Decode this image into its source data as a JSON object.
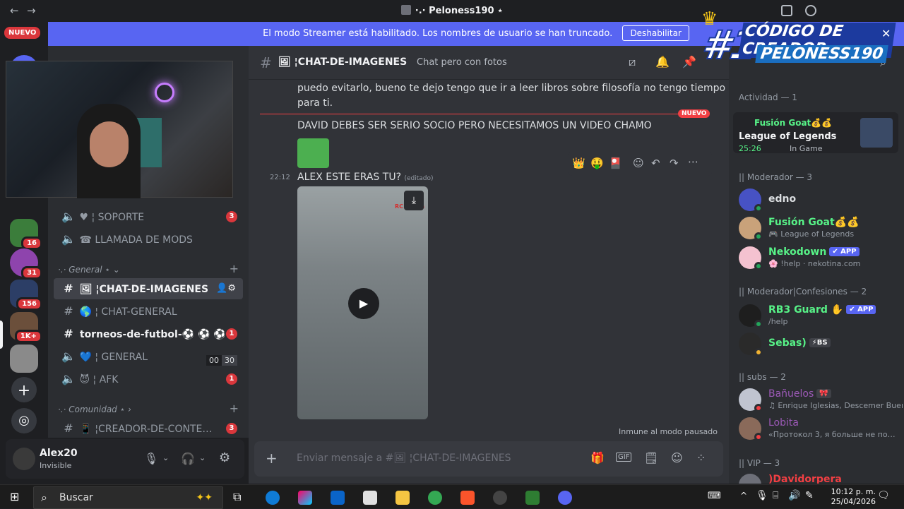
{
  "window": {
    "title": "·.· Peloness190 ⋆",
    "back": "←",
    "forward": "→"
  },
  "banner": {
    "text": "El modo Streamer está habilitado. Los nombres de usuario se han truncado.",
    "button": "Deshabilitar"
  },
  "promo": {
    "line1": "#1",
    "line2": "CÓDIGO DE CREADOR:",
    "line3": "PELONESS190"
  },
  "servers": {
    "nuevo": "NUEVO",
    "badges": [
      "16",
      "31",
      "156",
      "1K+"
    ]
  },
  "sidebar": {
    "channels_top": [
      {
        "icon": "speaker",
        "label": "♥ ¦ SOPORTE",
        "count": "3"
      },
      {
        "icon": "speaker",
        "label": "☎ LLAMADA DE MODS"
      }
    ],
    "category_general": "·.· General ⋆ ⌄",
    "channels_general": [
      {
        "icon": "#",
        "label": "🖼 ¦CHAT-DE-IMAGENES",
        "active": true
      },
      {
        "icon": "#",
        "label": "🌎 ¦ CHAT-GENERAL"
      },
      {
        "icon": "#",
        "label": "torneos-de-futbol-⚽ ⚽ ⚽",
        "count": "1",
        "unread": true
      },
      {
        "icon": "speaker",
        "label": "💙 ¦ GENERAL",
        "voice": [
          "00",
          "30"
        ]
      },
      {
        "icon": "speaker",
        "label": "😈 ¦ AFK",
        "count": "1"
      }
    ],
    "category_comunidad": "·.· Comunidad ⋆ ›",
    "channels_comunidad": [
      {
        "icon": "#",
        "label": "📱 ¦CREADOR-DE-CONTE…",
        "count": "3"
      }
    ]
  },
  "user": {
    "name": "Alex20",
    "status": "Invisible"
  },
  "channel": {
    "name": "🖼 ¦CHAT-DE-IMAGENES",
    "topic": "Chat pero con fotos"
  },
  "messages": {
    "m1": "puedo evitarlo, bueno te dejo tengo que ir a leer libros sobre filosofía no tengo tiempo",
    "m1b": "para ti.",
    "new_badge": "NUEVO",
    "m2": "DAVID DEBES SER SERIO SOCIO PERO NECESITAMOS UN VIDEO CHAMO",
    "m3_time": "22:12",
    "m3": "ALEX ESTE ERAS TU?",
    "m3_edited": "(editado)",
    "video_watermark": "RC Media"
  },
  "immune": "Inmune al modo pausado",
  "composer": {
    "placeholder": "Enviar mensaje a #🖼 ¦CHAT-DE-IMAGENES"
  },
  "members": {
    "activity_header": "Actividad — 1",
    "activity": {
      "name": "Fusión Goat💰💰",
      "game": "League of Legends",
      "time": "25:26",
      "state": "In Game"
    },
    "mod_header": "|| Moderador — 3",
    "mods": [
      {
        "name": "edno",
        "sub": "",
        "color": "#dbdee1"
      },
      {
        "name": "Fusión Goat💰💰",
        "sub": "🎮 League of Legends",
        "color": "#57f287"
      },
      {
        "name": "Nekodown",
        "tag": "✔ APP",
        "sub": "🌸 !help · nekotina.com",
        "color": "#57f287"
      }
    ],
    "conf_header": "|| Moderador|Confesiones — 2",
    "conf": [
      {
        "name": "RB3 Guard ✋",
        "tag": "✔ APP",
        "sub": "/help",
        "color": "#57f287"
      },
      {
        "name": "Sebas)",
        "tag": "⚡BS",
        "sub": "",
        "color": "#57f287"
      }
    ],
    "subs_header": "|| subs — 2",
    "subs": [
      {
        "name": "Bañuelos",
        "tag": "🎀",
        "sub": "♫ Enrique Iglesias, Descemer Buenc",
        "color": "#9b59b6"
      },
      {
        "name": "Lobita",
        "sub": "«Протокол 3, я больше не по…",
        "color": "#9b59b6"
      }
    ],
    "vip_header": "|| VIP — 3",
    "vip_partial": ")Davidorpera"
  },
  "taskbar": {
    "search": "Buscar",
    "time": "10:12 p. m.",
    "date": "25/04/2026"
  }
}
